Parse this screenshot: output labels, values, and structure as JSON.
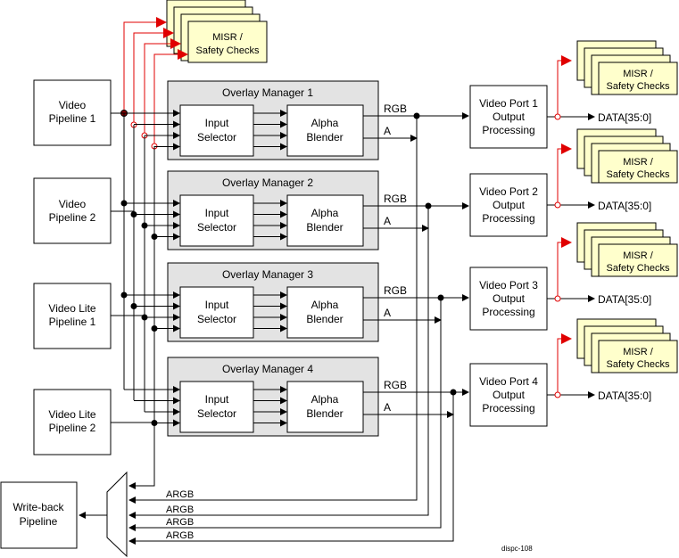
{
  "diagram": {
    "figure_id": "dispc-108",
    "sources": [
      {
        "line1": "Video",
        "line2": "Pipeline 1"
      },
      {
        "line1": "Video",
        "line2": "Pipeline 2"
      },
      {
        "line1": "Video Lite",
        "line2": "Pipeline 1"
      },
      {
        "line1": "Video Lite",
        "line2": "Pipeline 2"
      }
    ],
    "overlay_managers": [
      {
        "title": "Overlay Manager 1"
      },
      {
        "title": "Overlay Manager 2"
      },
      {
        "title": "Overlay Manager 3"
      },
      {
        "title": "Overlay Manager 4"
      }
    ],
    "input_selector": {
      "line1": "Input",
      "line2": "Selector"
    },
    "alpha_blender": {
      "line1": "Alpha",
      "line2": "Blender"
    },
    "rgb_label": "RGB",
    "alpha_label": "A",
    "video_ports": [
      {
        "line1": "Video Port 1",
        "line2": "Output",
        "line3": "Processing"
      },
      {
        "line1": "Video Port 2",
        "line2": "Output",
        "line3": "Processing"
      },
      {
        "line1": "Video Port 3",
        "line2": "Output",
        "line3": "Processing"
      },
      {
        "line1": "Video Port 4",
        "line2": "Output",
        "line3": "Processing"
      }
    ],
    "data_output_label": "DATA[35:0]",
    "misr": {
      "line1": "MISR /",
      "line2": "Safety Checks"
    },
    "writeback": {
      "line1": "Write-back",
      "line2": "Pipeline"
    },
    "argb_label": "ARGB",
    "colors": {
      "safety_path": "#e00000",
      "overlay_fill": "#e3e3e3",
      "misr_fill": "#ffffcc"
    }
  }
}
